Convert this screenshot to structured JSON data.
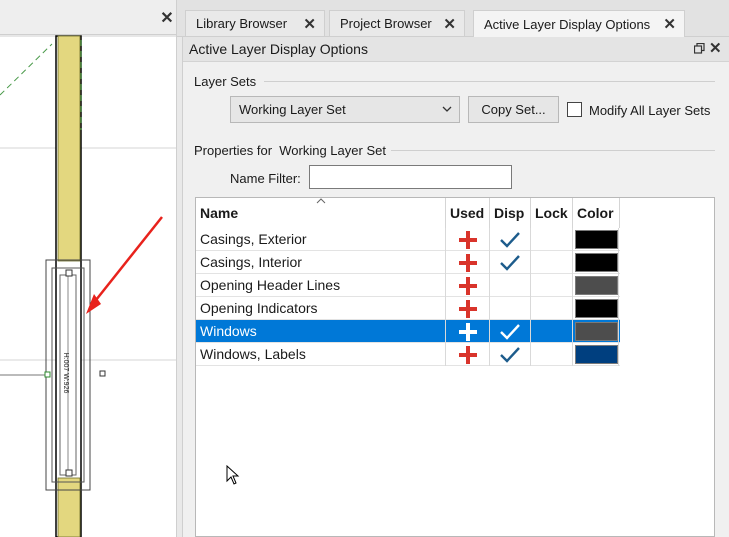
{
  "tabs": [
    {
      "label": "Library Browser",
      "close": "✕",
      "active": false
    },
    {
      "label": "Project Browser",
      "close": "✕",
      "active": false
    },
    {
      "label": "Active Layer Display Options",
      "close": "✕",
      "active": true
    }
  ],
  "drawing": {
    "close": "✕",
    "dimension_text": "H:007 W:926"
  },
  "panel": {
    "title": "Active Layer Display Options",
    "close": "✕",
    "layer_sets_label": "Layer Sets",
    "layer_set_selected": "Working Layer Set",
    "copy_set_label": "Copy Set...",
    "modify_all_label": "Modify All Layer Sets",
    "modify_all_checked": false,
    "properties_label": "Properties for  Working Layer Set",
    "name_filter_label": "Name Filter:",
    "name_filter_value": ""
  },
  "table": {
    "columns": [
      "Name",
      "Used",
      "Disp",
      "Lock",
      "Color"
    ],
    "rows": [
      {
        "name": "Casings, Exterior",
        "used": true,
        "disp": true,
        "lock": false,
        "color": "#000000",
        "selected": false
      },
      {
        "name": "Casings, Interior",
        "used": true,
        "disp": true,
        "lock": false,
        "color": "#000000",
        "selected": false
      },
      {
        "name": "Opening Header Lines",
        "used": true,
        "disp": false,
        "lock": false,
        "color": "#4d4d4d",
        "selected": false
      },
      {
        "name": "Opening Indicators",
        "used": true,
        "disp": false,
        "lock": false,
        "color": "#000000",
        "selected": false
      },
      {
        "name": "Windows",
        "used": true,
        "disp": true,
        "lock": false,
        "color": "#4d4d4d",
        "selected": true
      },
      {
        "name": "Windows, Labels",
        "used": true,
        "disp": true,
        "lock": false,
        "color": "#003f7f",
        "selected": false
      }
    ]
  },
  "colors": {
    "used_plus": "#d9342b",
    "disp_check": "#1d5c8c",
    "selection": "#0078d7",
    "arrow": "#e8221c",
    "wall_fill": "#e3d77f"
  },
  "icons": {
    "used": "plus-icon",
    "disp": "checkmark-icon",
    "restore": "restore-window-icon",
    "dropdown": "chevron-down-icon"
  }
}
